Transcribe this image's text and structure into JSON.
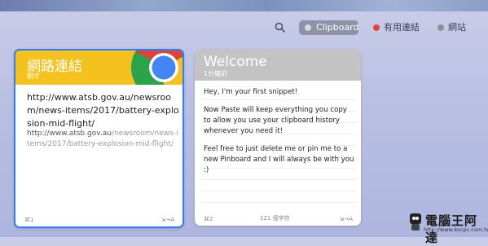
{
  "toolbar": {
    "search_icon": "search-icon",
    "tabs": [
      {
        "label": "Clipboard",
        "color": "#d7d9e0",
        "active": true
      },
      {
        "label": "有用連結",
        "color": "#e8413c",
        "active": false
      },
      {
        "label": "網站",
        "color": "#8d8f99",
        "active": false
      }
    ]
  },
  "cards": [
    {
      "title": "網路連結",
      "subtitle": "剛才",
      "header_color": "#f4c11f",
      "icon": "chrome-icon",
      "main_text": "http://www.atsb.gov.au/newsroom/news-items/2017/battery-explosion-mid-flight/",
      "url_host": "http://www.atsb.gov.au",
      "url_path": "/newsroom/news-items/2017/battery-explosion-mid-flight/",
      "shortcut": "⌘1",
      "type_indicator": "⇲→A"
    },
    {
      "title": "Welcome",
      "subtitle": "1分鐘前",
      "header_color": "#c3c3c3",
      "paragraphs": [
        "Hey, I'm your first snippet!",
        "Now Paste will keep everything you copy to allow you use your clipboard history whenever you need it!",
        "Feel free to just delete me or pin me to a new Pinboard and I will always be with you :)"
      ],
      "shortcut": "⌘2",
      "char_count": "221 個字符",
      "type_indicator": "⇲→A"
    }
  ],
  "watermark": {
    "title": "電腦王阿達",
    "url": "http://www.kocpc.com.tw"
  }
}
